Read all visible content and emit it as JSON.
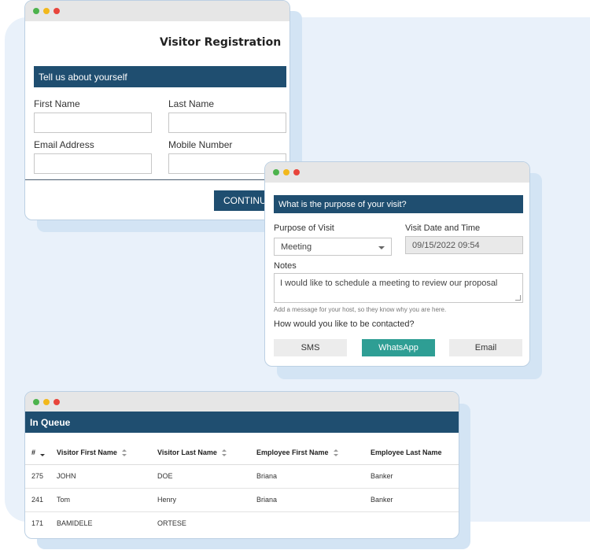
{
  "registration": {
    "title": "Visitor Registration",
    "section": "Tell us about yourself",
    "first_name_label": "First Name",
    "last_name_label": "Last Name",
    "email_label": "Email Address",
    "mobile_label": "Mobile Number",
    "continue_label": "CONTINUE"
  },
  "visit": {
    "section": "What is the purpose of your visit?",
    "purpose_label": "Purpose of Visit",
    "purpose_value": "Meeting",
    "datetime_label": "Visit Date and Time",
    "datetime_value": "09/15/2022 09:54",
    "notes_label": "Notes",
    "notes_value": "I would like to schedule a meeting to review our proposal",
    "notes_hint": "Add a message for your host, so they know why you are here.",
    "contact_label": "How would you like to be contacted?",
    "contact_options": [
      "SMS",
      "WhatsApp",
      "Email"
    ],
    "contact_selected": "WhatsApp"
  },
  "queue": {
    "title": "In Queue",
    "columns": [
      "#",
      "Visitor First Name",
      "Visitor Last Name",
      "Employee First Name",
      "Employee Last Name"
    ],
    "rows": [
      [
        "275",
        "JOHN",
        "DOE",
        "Briana",
        "Banker"
      ],
      [
        "241",
        "Tom",
        "Henry",
        "Briana",
        "Banker"
      ],
      [
        "171",
        "BAMIDELE",
        "ORTESE",
        "",
        ""
      ]
    ]
  },
  "colors": {
    "accent": "#1f4e70",
    "selected": "#2e9e94",
    "background": "#e9f1fa"
  }
}
